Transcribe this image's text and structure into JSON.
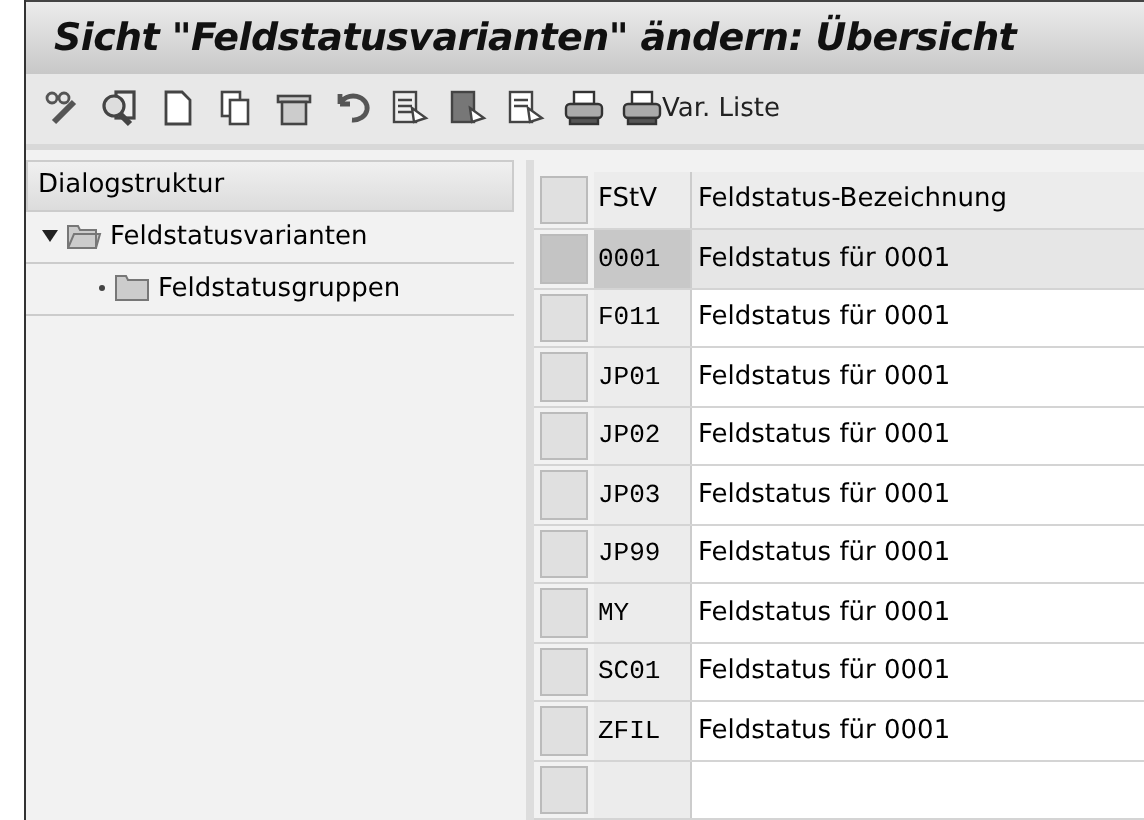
{
  "window": {
    "title": "Sicht \"Feldstatusvarianten\" ändern: Übersicht"
  },
  "toolbar": [
    {
      "kind": "glasses-pencil"
    },
    {
      "kind": "find"
    },
    {
      "kind": "new"
    },
    {
      "kind": "copy"
    },
    {
      "kind": "delete"
    },
    {
      "kind": "undo"
    },
    {
      "kind": "select-all"
    },
    {
      "kind": "select-block"
    },
    {
      "kind": "deselect"
    },
    {
      "kind": "print"
    },
    {
      "kind": "print",
      "label": "Var. Liste"
    }
  ],
  "sidebar": {
    "title": "Dialogstruktur",
    "items": [
      {
        "label": "Feldstatusvarianten",
        "expanded": true,
        "children": [
          {
            "label": "Feldstatusgruppen"
          }
        ]
      }
    ]
  },
  "table": {
    "columns": [
      "FStV",
      "Feldstatus-Bezeichnung"
    ],
    "rows": [
      {
        "code": "0001",
        "text": "Feldstatus für 0001",
        "selected": true
      },
      {
        "code": "F011",
        "text": "Feldstatus für 0001",
        "selected": false
      },
      {
        "code": "JP01",
        "text": "Feldstatus für 0001",
        "selected": false
      },
      {
        "code": "JP02",
        "text": "Feldstatus für 0001",
        "selected": false
      },
      {
        "code": "JP03",
        "text": "Feldstatus für 0001",
        "selected": false
      },
      {
        "code": "JP99",
        "text": "Feldstatus für 0001",
        "selected": false
      },
      {
        "code": "MY",
        "text": "Feldstatus für 0001",
        "selected": false
      },
      {
        "code": "SC01",
        "text": "Feldstatus für 0001",
        "selected": false
      },
      {
        "code": "ZFIL",
        "text": "Feldstatus für 0001",
        "selected": false
      }
    ]
  }
}
